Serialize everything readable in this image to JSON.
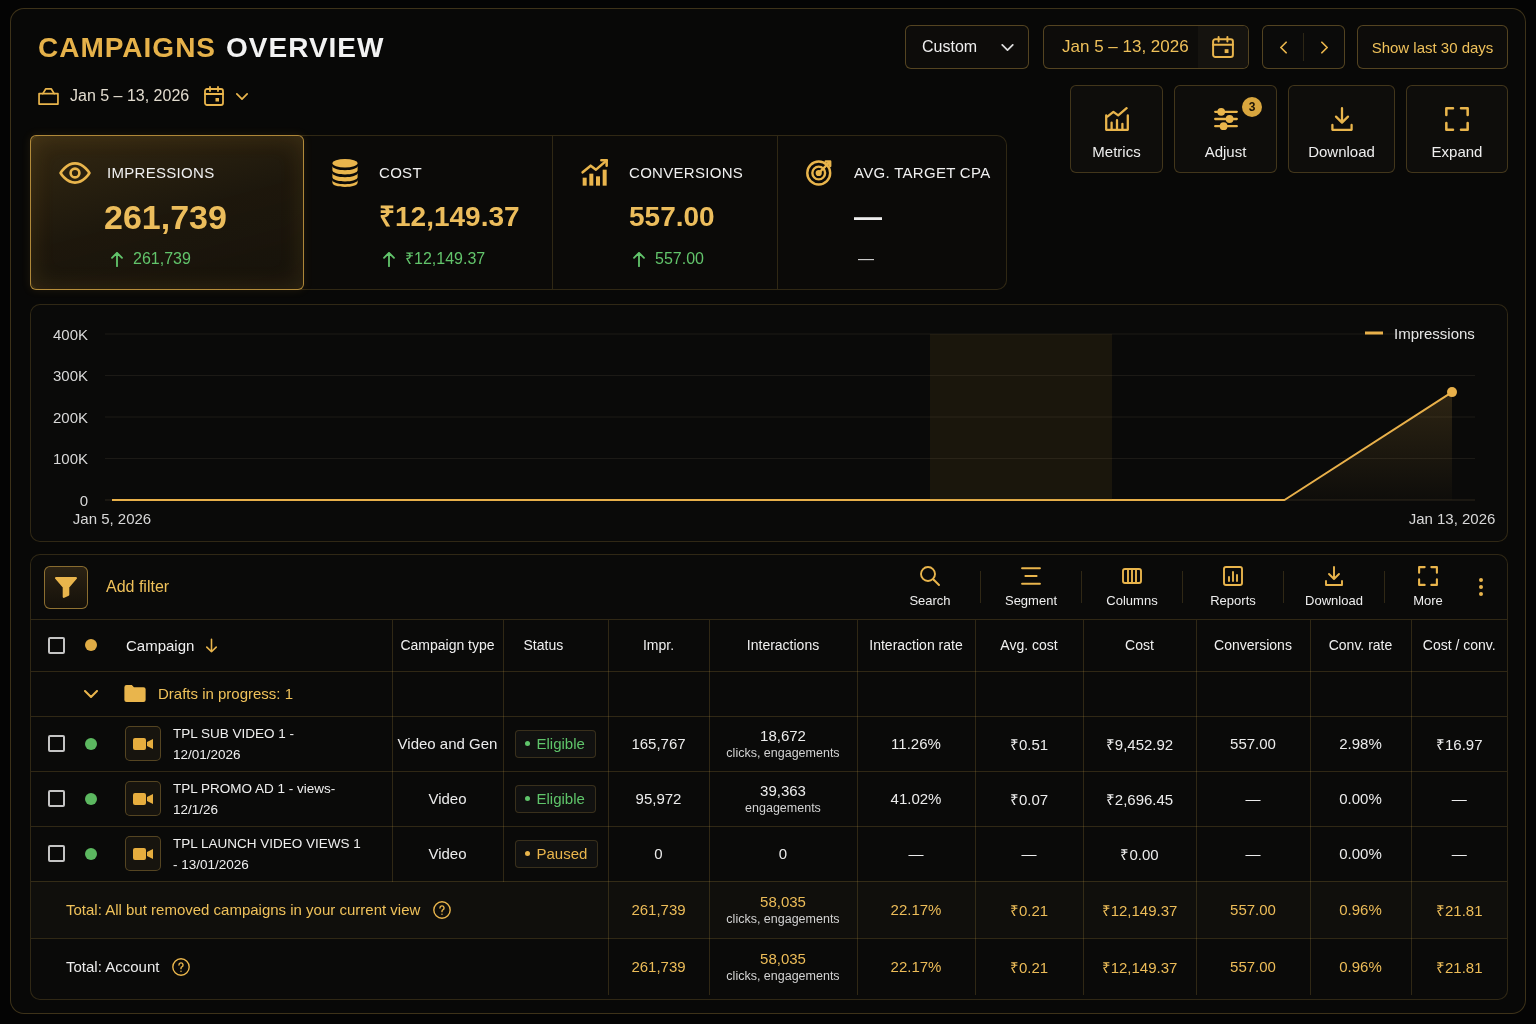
{
  "header": {
    "title": {
      "accent": "CAMPAIGNS",
      "rest": "OVERVIEW"
    },
    "date_range": "Jan 5 – 13, 2026"
  },
  "controls": {
    "period_select": {
      "value": "Custom"
    },
    "date_field": {
      "value": "Jan 5 – 13, 2026"
    },
    "quick_range_button": "Show last 30 days"
  },
  "tools": [
    {
      "label": "Metrics"
    },
    {
      "label": "Adjust",
      "badge": "3"
    },
    {
      "label": "Download"
    },
    {
      "label": "Expand"
    }
  ],
  "kpis": [
    {
      "label": "IMPRESSIONS",
      "value": "261,739",
      "change": "261,739",
      "rising": true,
      "selected": true
    },
    {
      "label": "COST",
      "value": "₹12,149.37",
      "change": "₹12,149.37",
      "rising": true,
      "selected": false
    },
    {
      "label": "CONVERSIONS",
      "value": "557.00",
      "change": "557.00",
      "rising": true,
      "selected": false
    },
    {
      "label": "AVG. TARGET CPA",
      "value": "—",
      "change": "—",
      "rising": false,
      "selected": false
    }
  ],
  "chart": {
    "hover_highlight": true,
    "chart_data": {
      "type": "area",
      "categories": [
        "Jan 5, 2026",
        null,
        null,
        null,
        null,
        null,
        null,
        null,
        "Jan 13, 2026"
      ],
      "ylim": [
        0,
        400000
      ],
      "yticks": [
        {
          "value": 0,
          "label": "0"
        },
        {
          "value": 100000,
          "label": "100K"
        },
        {
          "value": 200000,
          "label": "200K"
        },
        {
          "value": 300000,
          "label": "300K"
        },
        {
          "value": 400000,
          "label": "400K"
        }
      ],
      "grid": true,
      "series": [
        {
          "name": "Impressions",
          "color": "#e8b04a",
          "values": [
            0,
            0,
            0,
            0,
            0,
            0,
            0,
            0,
            260000
          ]
        }
      ]
    }
  },
  "table": {
    "toolbar": {
      "filter_label": "Add filter",
      "tools": [
        "Search",
        "Segment",
        "Columns",
        "Reports",
        "Download",
        "More"
      ]
    },
    "select_all": {
      "checked": false
    },
    "columns": [
      {
        "label": "Campaign",
        "sorted": true
      },
      {
        "label": "Campaign type",
        "sorted": false
      },
      {
        "label": "Status",
        "sorted": false
      },
      {
        "label": "Impr.",
        "sorted": false
      },
      {
        "label": "Interactions",
        "sorted": false
      },
      {
        "label": "Interaction rate",
        "sorted": false
      },
      {
        "label": "Avg. cost",
        "sorted": false
      },
      {
        "label": "Cost",
        "sorted": false
      },
      {
        "label": "Conversions",
        "sorted": false
      },
      {
        "label": "Conv. rate",
        "sorted": false
      },
      {
        "label": "Cost / conv.",
        "sorted": false
      }
    ],
    "group": {
      "label": "Drafts in progress: 1",
      "expanded": true
    },
    "rows": [
      {
        "checked": false,
        "color": "#5cb860",
        "campaign": "TPL SUB VIDEO 1 - 12/01/2026",
        "type": "Video and Gen",
        "status": {
          "label": "Eligible",
          "kind": "eligible"
        },
        "impressions": "165,767",
        "interactions": {
          "value": "18,672",
          "detail": "clicks, engagements"
        },
        "interaction_rate": "11.26%",
        "avg_cost": "₹0.51",
        "cost": "₹9,452.92",
        "conversions": "557.00",
        "conv_rate": "2.98%",
        "cost_per_conv": "₹16.97"
      },
      {
        "checked": false,
        "color": "#5cb860",
        "campaign": "TPL PROMO AD 1 - views-12/1/26",
        "type": "Video",
        "status": {
          "label": "Eligible",
          "kind": "eligible"
        },
        "impressions": "95,972",
        "interactions": {
          "value": "39,363",
          "detail": "engagements"
        },
        "interaction_rate": "41.02%",
        "avg_cost": "₹0.07",
        "cost": "₹2,696.45",
        "conversions": "—",
        "conv_rate": "0.00%",
        "cost_per_conv": "—"
      },
      {
        "checked": false,
        "color": "#5cb860",
        "campaign": "TPL LAUNCH VIDEO VIEWS 1 - 13/01/2026",
        "type": "Video",
        "status": {
          "label": "Paused",
          "kind": "paused"
        },
        "impressions": "0",
        "interactions": {
          "value": "0"
        },
        "interaction_rate": "—",
        "avg_cost": "—",
        "cost": "₹0.00",
        "conversions": "—",
        "conv_rate": "0.00%",
        "cost_per_conv": "—"
      }
    ],
    "totals": [
      {
        "label": "Total: All but removed campaigns in your current view",
        "highlighted": true,
        "impressions": "261,739",
        "interactions": {
          "value": "58,035",
          "detail": "clicks, engagements"
        },
        "interaction_rate": "22.17%",
        "avg_cost": "₹0.21",
        "cost": "₹12,149.37",
        "conversions": "557.00",
        "conv_rate": "0.96%",
        "cost_per_conv": "₹21.81"
      },
      {
        "label": "Total: Account",
        "highlighted": false,
        "impressions": "261,739",
        "interactions": {
          "value": "58,035",
          "detail": "clicks, engagements"
        },
        "interaction_rate": "22.17%",
        "avg_cost": "₹0.21",
        "cost": "₹12,149.37",
        "conversions": "557.00",
        "conv_rate": "0.96%",
        "cost_per_conv": "₹21.81"
      }
    ]
  }
}
